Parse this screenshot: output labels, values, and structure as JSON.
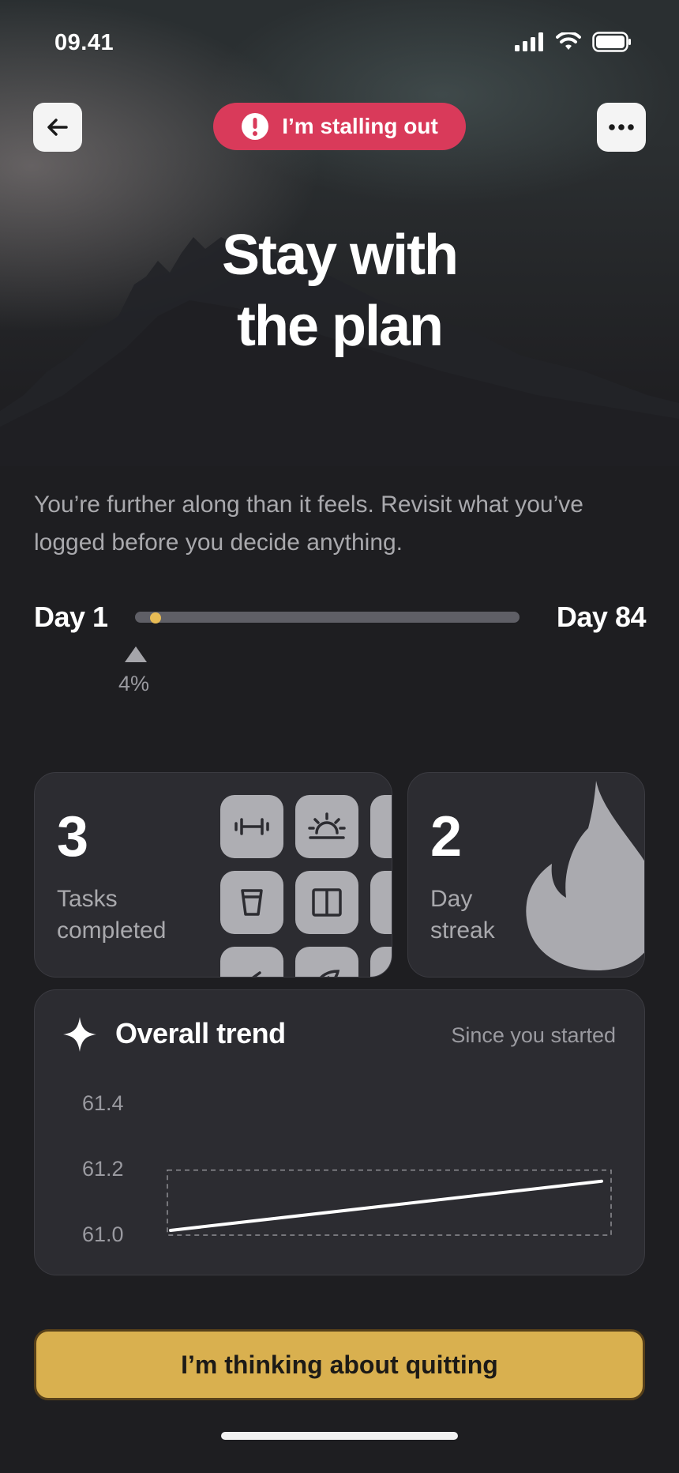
{
  "status_bar": {
    "time": "09.41"
  },
  "header": {
    "badge_label": "I’m stalling out"
  },
  "hero": {
    "title_line1": "Stay with",
    "title_line2": "the plan"
  },
  "subtitle": "You’re further along than it feels. Revisit what you’ve logged before you decide anything.",
  "progress": {
    "start_label": "Day 1",
    "end_label": "Day 84",
    "percent_label": "4%",
    "fraction": 0.04
  },
  "tasks": {
    "count": "3",
    "label_line1": "Tasks",
    "label_line2": "completed",
    "icons": [
      "dumbbell-icon",
      "sunrise-icon",
      "cup-icon",
      "columns-icon",
      "check-icon",
      "leaf-icon"
    ]
  },
  "streak": {
    "count": "2",
    "label_line1": "Day",
    "label_line2": "streak"
  },
  "trend": {
    "title": "Overall trend",
    "since_label": "Since you started"
  },
  "chart_data": {
    "type": "line",
    "title": "Overall trend",
    "yticks": [
      "61.4",
      "61.2",
      "61.0"
    ],
    "ylim": [
      61.0,
      61.4
    ],
    "series": [
      {
        "values": [
          61.0,
          61.15
        ]
      }
    ]
  },
  "cta": {
    "quit_label": "I’m thinking about quitting"
  },
  "colors": {
    "accent": "#d9b04f",
    "badge": "#d93a5a",
    "progress_dot": "#e7bb55"
  }
}
